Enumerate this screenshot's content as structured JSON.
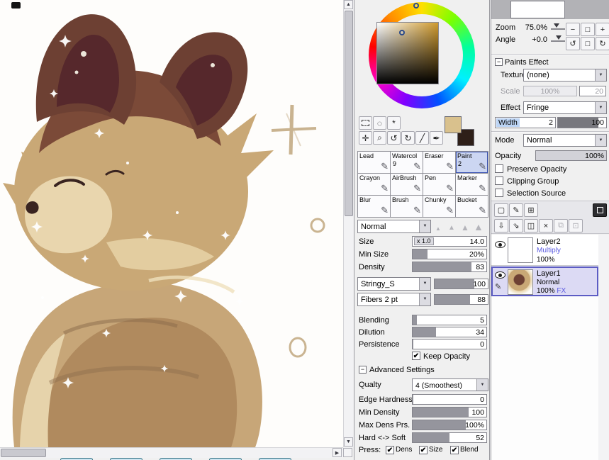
{
  "icons": {
    "up": "▲",
    "down": "▼",
    "left": "◀",
    "right": "▶",
    "drop": "▼",
    "check": "✔",
    "minus": "−",
    "tip": "▲",
    "pencil": "✎",
    "lasso": "◌",
    "wand": "*",
    "move": "✛",
    "zoom": "⌕",
    "rotate_ccw": "↺",
    "rotate_cw": "↻",
    "eyedropper": "╱",
    "pen": "✒",
    "zoom_out": "−",
    "zoom_in": "+",
    "reset": "□",
    "new_layer": "▢",
    "new_lineart": "✎",
    "new_folder": "⊞",
    "transfer_down": "⇩",
    "merge_down": "⇘",
    "clear_layer": "◫",
    "delete_layer": "×",
    "copy_layer": "⧉",
    "paste_layer": "⊡"
  },
  "swatches": {
    "foreground": "#d9c18d",
    "background": "#2e1f18"
  },
  "mid": {
    "blend_mode": "Normal",
    "brushes": [
      {
        "label": "Lead"
      },
      {
        "label": "Watercol",
        "num": "9"
      },
      {
        "label": "Eraser"
      },
      {
        "label": "Paint",
        "num": "2"
      },
      {
        "label": "Crayon"
      },
      {
        "label": "AirBrush"
      },
      {
        "label": "Pen"
      },
      {
        "label": "Marker"
      },
      {
        "label": "Blur"
      },
      {
        "label": "Brush"
      },
      {
        "label": "Chunky"
      },
      {
        "label": "Bucket"
      }
    ],
    "size": {
      "label": "Size",
      "chip": "x 1.0",
      "value": "14.0"
    },
    "min_size": {
      "label": "Min Size",
      "value": "20%",
      "fill": 20
    },
    "density": {
      "label": "Density",
      "value": "83",
      "fill": 80
    },
    "stringy": {
      "name": "Stringy_S",
      "value": "100",
      "fill": 74
    },
    "fibers": {
      "name": "Fibers 2 pt",
      "value": "88",
      "fill": 66
    },
    "blending": {
      "label": "Blending",
      "value": "5",
      "fill": 6
    },
    "dilution": {
      "label": "Dilution",
      "value": "34",
      "fill": 32
    },
    "persistence": {
      "label": "Persistence",
      "value": "0",
      "fill": 1
    },
    "keep_opacity": "Keep Opacity",
    "advanced_header": "Advanced Settings",
    "quality": {
      "label": "Qualty",
      "value": "4 (Smoothest)"
    },
    "edge_hardness": {
      "label": "Edge Hardness",
      "value": "0",
      "fill": 1
    },
    "min_density": {
      "label": "Min Density",
      "value": "100",
      "fill": 76
    },
    "max_dens": {
      "label": "Max Dens Prs.",
      "value": "100%",
      "fill": 72
    },
    "hard_soft": {
      "label": "Hard <-> Soft",
      "value": "52",
      "fill": 50
    },
    "press_label": "Press:",
    "press": [
      {
        "label": "Dens"
      },
      {
        "label": "Size"
      },
      {
        "label": "Blend"
      }
    ]
  },
  "nav": {
    "zoom_label": "Zoom",
    "zoom_value": "75.0%",
    "angle_label": "Angle",
    "angle_value": "+0.0"
  },
  "pe": {
    "header": "Paints Effect",
    "texture_label": "Texture",
    "texture_value": "(none)",
    "scale_label": "Scale",
    "scale_value": "100%",
    "scale_num": "20",
    "effect_label": "Effect",
    "effect_value": "Fringe",
    "width_label": "Width",
    "width_num": "2",
    "width_value": "100",
    "width_fill": 84
  },
  "layers": {
    "mode_label": "Mode",
    "mode_value": "Normal",
    "opacity_label": "Opacity",
    "opacity_value": "100%",
    "opacity_fill": 100,
    "options": [
      "Preserve Opacity",
      "Clipping Group",
      "Selection Source"
    ],
    "items": [
      {
        "name": "Layer2",
        "mode": "Multiply",
        "opacity": "100%"
      },
      {
        "name": "Layer1",
        "mode": "Normal",
        "opacity": "100%",
        "fx": "FX"
      }
    ]
  }
}
